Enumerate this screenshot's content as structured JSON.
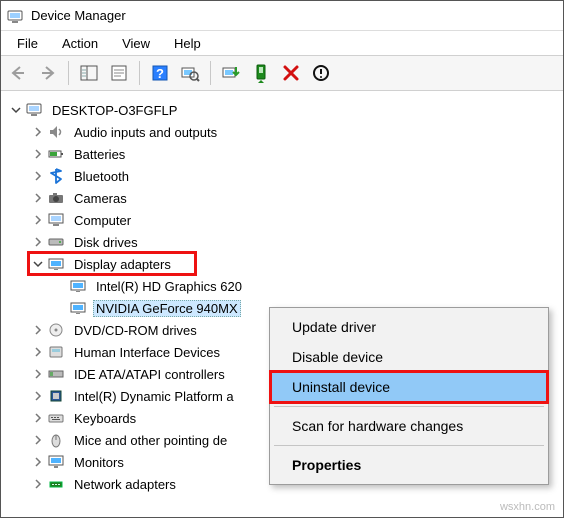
{
  "window": {
    "title": "Device Manager"
  },
  "menubar": {
    "file": "File",
    "action": "Action",
    "view": "View",
    "help": "Help"
  },
  "root": {
    "name": "DESKTOP-O3FGFLP"
  },
  "categories": {
    "audio": "Audio inputs and outputs",
    "batteries": "Batteries",
    "bluetooth": "Bluetooth",
    "cameras": "Cameras",
    "computer": "Computer",
    "disk": "Disk drives",
    "display": "Display adapters",
    "display_children": {
      "intel": "Intel(R) HD Graphics 620",
      "nvidia": "NVIDIA GeForce 940MX"
    },
    "dvd": "DVD/CD-ROM drives",
    "hid": "Human Interface Devices",
    "ide": "IDE ATA/ATAPI controllers",
    "dptf": "Intel(R) Dynamic Platform a",
    "keyboards": "Keyboards",
    "mice": "Mice and other pointing de",
    "monitors": "Monitors",
    "network": "Network adapters"
  },
  "context_menu": {
    "update": "Update driver",
    "disable": "Disable device",
    "uninstall": "Uninstall device",
    "scan": "Scan for hardware changes",
    "properties": "Properties"
  }
}
